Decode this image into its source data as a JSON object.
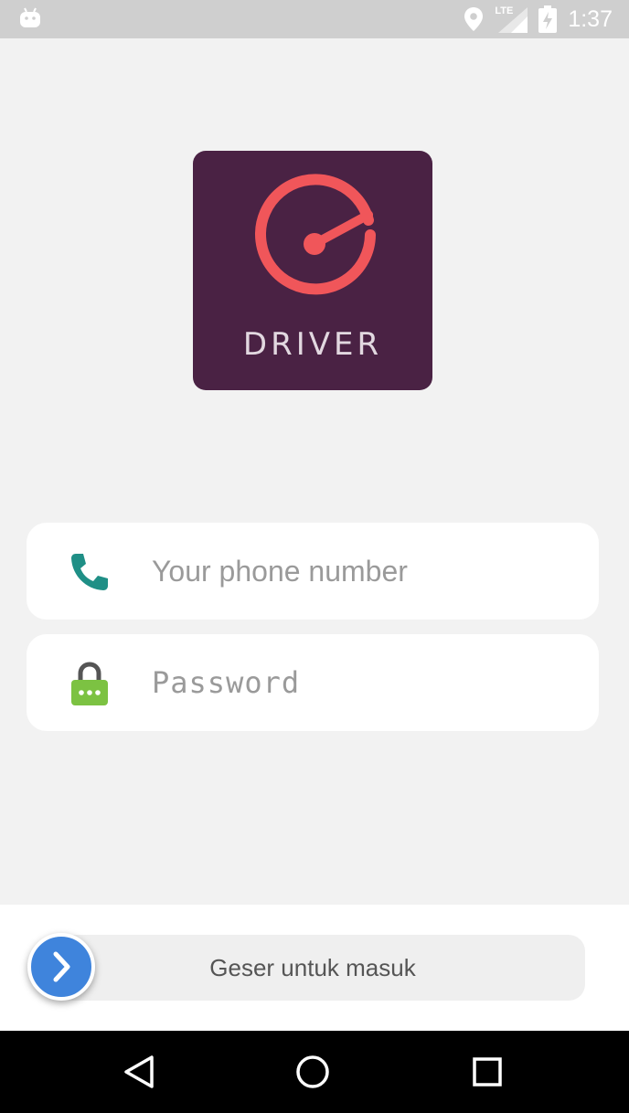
{
  "status_bar": {
    "network": "LTE",
    "time": "1:37"
  },
  "logo": {
    "text": "DRIVER",
    "background": "#4a2244",
    "accent": "#f0565a"
  },
  "form": {
    "phone_placeholder": "Your phone number",
    "password_placeholder": "Password"
  },
  "slider": {
    "label": "Geser untuk masuk",
    "knob_color": "#3f84dc"
  },
  "icons": {
    "phone": "phone-icon",
    "password": "lock-icon",
    "slider": "chevron-right-icon",
    "back": "back-triangle-icon",
    "home": "home-circle-icon",
    "recents": "recents-square-icon"
  }
}
